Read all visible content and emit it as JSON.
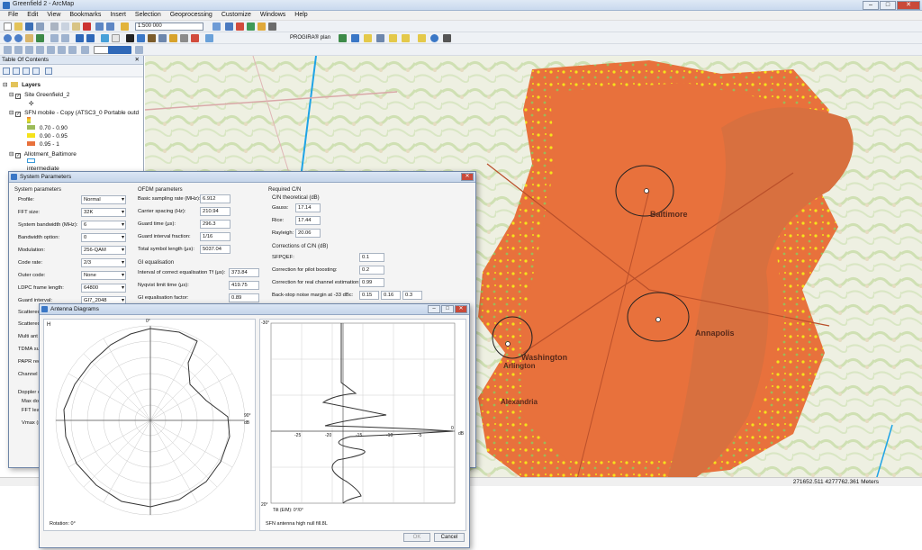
{
  "window": {
    "title": "Greenfield 2 - ArcMap"
  },
  "menu": [
    "File",
    "Edit",
    "View",
    "Bookmarks",
    "Insert",
    "Selection",
    "Geoprocessing",
    "Customize",
    "Windows",
    "Help"
  ],
  "toolbar": {
    "scale": "1:500 000",
    "plan_label": "PROGIRA® plan"
  },
  "toc": {
    "title": "Table Of Contents",
    "root": "Layers",
    "items": [
      {
        "label": "Site Greenfield_2"
      },
      {
        "label": "SFN mobile - Copy (ATSC3_0  Portable outd"
      },
      {
        "label": "Allotment_Baltimore"
      },
      {
        "label": "intermediate"
      }
    ],
    "legend": [
      {
        "label": "0.70 - 0.90",
        "color": "#9bbb59"
      },
      {
        "label": "0.90 - 0.95",
        "color": "#f5e21b"
      },
      {
        "label": "0.95 - 1",
        "color": "#e8713c"
      }
    ]
  },
  "map": {
    "labels": [
      "Baltimore",
      "Annapolis",
      "Washington",
      "Arlington",
      "Alexandria"
    ],
    "coverage_color": "#e8713c"
  },
  "status": {
    "coords": "271652.511  4277762.361 Meters"
  },
  "sysparams": {
    "title": "System Parameters",
    "system_heading": "System parameters",
    "rows": [
      {
        "label": "Profile:",
        "value": "Normal"
      },
      {
        "label": "FFT size:",
        "value": "32K"
      },
      {
        "label": "System bandwidth (MHz):",
        "value": "6"
      },
      {
        "label": "Bandwidth option:",
        "value": "0"
      },
      {
        "label": "Modulation:",
        "value": "256-QAM"
      },
      {
        "label": "Code rate:",
        "value": "2/3"
      },
      {
        "label": "Outer code:",
        "value": "None"
      },
      {
        "label": "LDPC frame length:",
        "value": "64800"
      },
      {
        "label": "Guard interval:",
        "value": "GI7_2048"
      }
    ],
    "hidden_rows": [
      "Scattered",
      "Scattered",
      "Multi ant",
      "TDMA su",
      "PAPR red",
      "Channel",
      "Doppler c",
      "Max dop",
      "FFT leak",
      "Vmax (r"
    ],
    "ofdm_heading": "OFDM parameters",
    "ofdm": [
      {
        "label": "Basic sampling rate (MHz):",
        "value": "6.912"
      },
      {
        "label": "Carrier spacing (Hz):",
        "value": "210.94"
      },
      {
        "label": "Guard time (μs):",
        "value": "296.3"
      },
      {
        "label": "Guard interval fraction:",
        "value": "1/16"
      },
      {
        "label": "Total symbol length (μs):",
        "value": "5037.04"
      }
    ],
    "gi_heading": "GI equalisation",
    "gi": [
      {
        "label": "Interval of correct equalisation Tf (μs):",
        "value": "373.84"
      },
      {
        "label": "Nyqvist limit time (μs):",
        "value": "419.75"
      },
      {
        "label": "GI equalisation factor:",
        "value": "0.89"
      }
    ],
    "cn_heading": "Required C/N",
    "cn_theo_heading": "C/N theoretical (dB)",
    "cn": [
      {
        "label": "Gauss:",
        "value": "17.14"
      },
      {
        "label": "Rice:",
        "value": "17.44"
      },
      {
        "label": "Rayleigh:",
        "value": "20.06"
      }
    ],
    "corr_heading": "Corrections of C/N (dB)",
    "corr": [
      {
        "label": "SFPQEF:",
        "value": "0.1"
      },
      {
        "label": "Correction for pilot boosting:",
        "value": "0.2"
      },
      {
        "label": "Correction for real channel estimation:",
        "value": "0.99"
      }
    ],
    "backstop": {
      "label": "Back-stop noise margin at -33 dBc:",
      "values": [
        "0.15",
        "0.16",
        "0.3"
      ]
    }
  },
  "antenna": {
    "title": "Antenna Diagrams",
    "h_label": "H",
    "top_label": "0°",
    "right_label": "90°",
    "db_label": "dB",
    "rotation": "Rotation: 0°",
    "v_top": "-30°",
    "v_bottom": "20°",
    "v_ticks": [
      "-25",
      "-20",
      "-15",
      "-10",
      "-5",
      "0"
    ],
    "tilt": "Tilt (E/M): 0°/0°",
    "caption": "SFN antenna high null fill.8L",
    "ok": "OK",
    "cancel": "Cancel"
  }
}
